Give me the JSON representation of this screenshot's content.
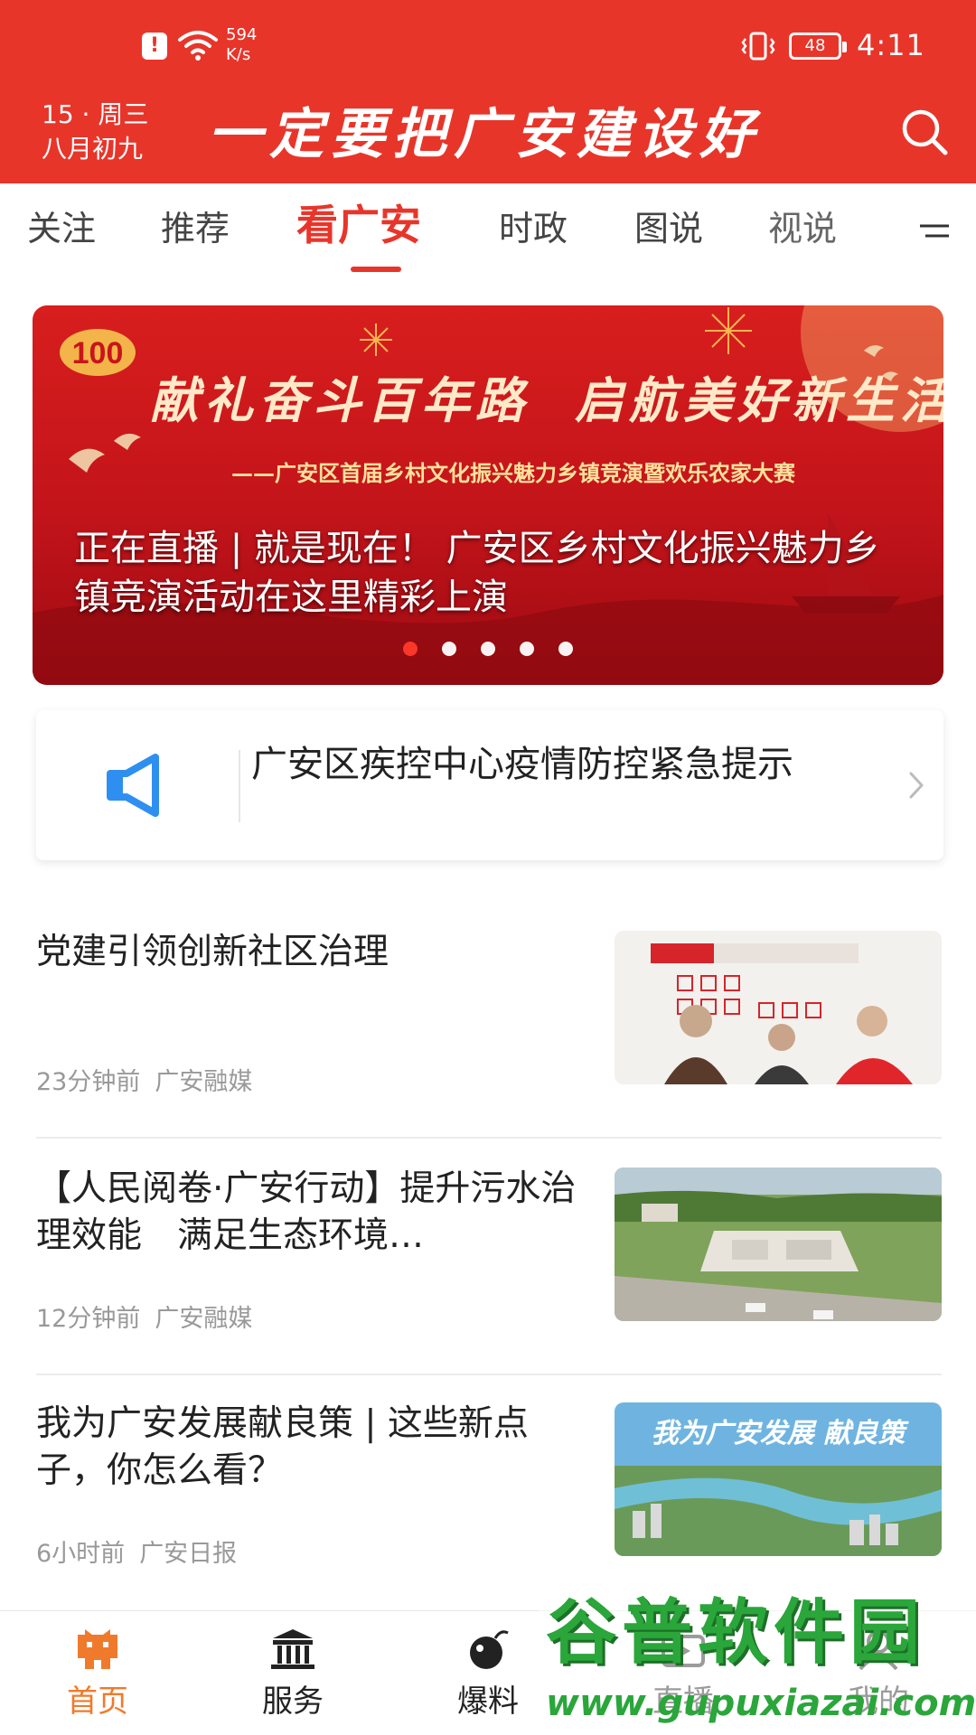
{
  "status_bar": {
    "speed_value": "594",
    "speed_unit": "K/s",
    "battery": "48",
    "time": "4:11"
  },
  "header": {
    "date_line1": "15 · 周三",
    "date_line2": "八月初九",
    "slogan": "一定要把广安建设好",
    "brand_color": "#e8352a"
  },
  "tabs": [
    {
      "label": "关注",
      "active": false
    },
    {
      "label": "推荐",
      "active": false
    },
    {
      "label": "看广安",
      "active": true
    },
    {
      "label": "时政",
      "active": false
    },
    {
      "label": "图说",
      "active": false
    },
    {
      "label": "视说",
      "active": false
    }
  ],
  "banner": {
    "headline_left": "献礼奋斗百年路",
    "headline_right": "启航美好新生活",
    "subtitle": "——广安区首届乡村文化振兴魅力乡镇竞演暨欢乐农家大赛",
    "caption": "正在直播 | 就是现在！ 广安区乡村文化振兴魅力乡镇竞演活动在这里精彩上演",
    "dots_total": 5,
    "dots_active_index": 0
  },
  "notice": {
    "icon": "megaphone-icon",
    "text": "广安区疾控中心疫情防控紧急提示"
  },
  "news": [
    {
      "title": "党建引领创新社区治理",
      "time": "23分钟前",
      "source": "广安融媒"
    },
    {
      "title": "【人民阅卷·广安行动】提升污水治理效能　满足生态环境…",
      "time": "12分钟前",
      "source": "广安融媒"
    },
    {
      "title": "我为广安发展献良策 | 这些新点子，你怎么看？",
      "time": "6小时前",
      "source": "广安日报",
      "thumb_text": "我为广安发展 献良策"
    }
  ],
  "bottom_nav": [
    {
      "label": "首页",
      "icon": "home-icon",
      "active": true
    },
    {
      "label": "服务",
      "icon": "building-icon",
      "active": false
    },
    {
      "label": "爆料",
      "icon": "bomb-icon",
      "active": false
    },
    {
      "label": "直播",
      "icon": "live-icon",
      "active": false
    },
    {
      "label": "我的",
      "icon": "user-icon",
      "active": false
    }
  ],
  "watermark": {
    "title": "谷普软件园",
    "url": "www.gupuxiazai.com"
  }
}
